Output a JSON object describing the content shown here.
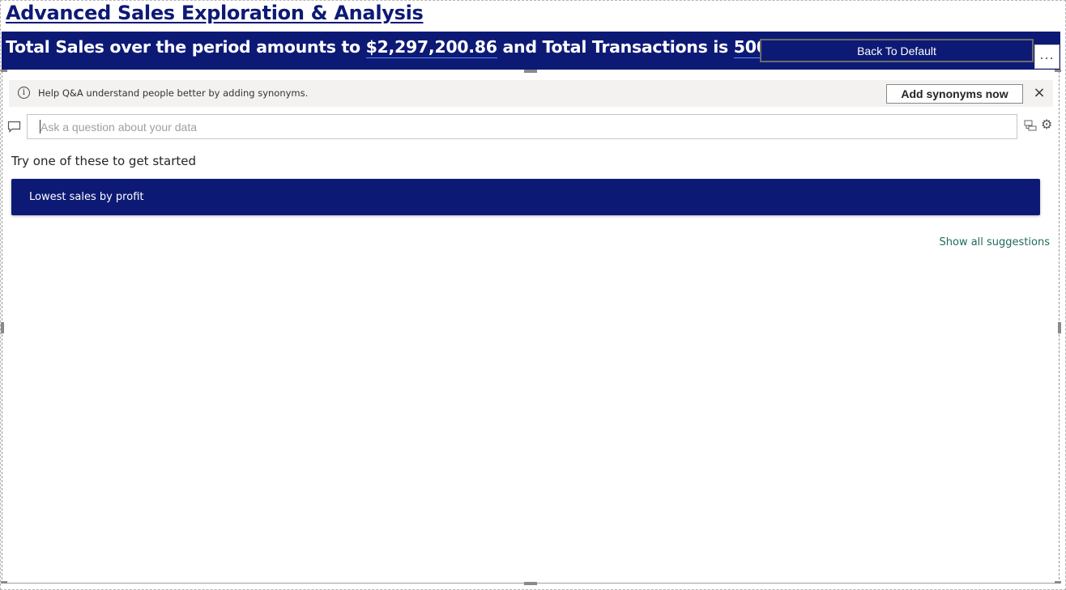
{
  "report": {
    "title": "Advanced Sales Exploration & Analysis"
  },
  "banner": {
    "text_before": "Total Sales over the period amounts to ",
    "total_sales": "$2,297,200.86",
    "text_middle": " and Total Transactions is ",
    "total_transactions": "5009",
    "back_button_label": "Back To Default",
    "more_options_label": "...",
    "background_color": "#0d1a75"
  },
  "synonym_bar": {
    "info_icon": "i",
    "message": "Help Q&A understand people better by adding synonyms.",
    "add_button_label": "Add synonyms now",
    "close_icon": "×"
  },
  "qa": {
    "placeholder": "Ask a question about your data",
    "value": "",
    "try_heading": "Try one of these to get started",
    "suggestions": [
      "Lowest sales by profit"
    ],
    "show_all_label": "Show all suggestions"
  },
  "icons": {
    "chat": "chat-icon",
    "convert": "convert-visual-icon",
    "gear": "gear-icon"
  },
  "colors": {
    "accent": "#0d1a75",
    "link": "#1e6b5c"
  }
}
